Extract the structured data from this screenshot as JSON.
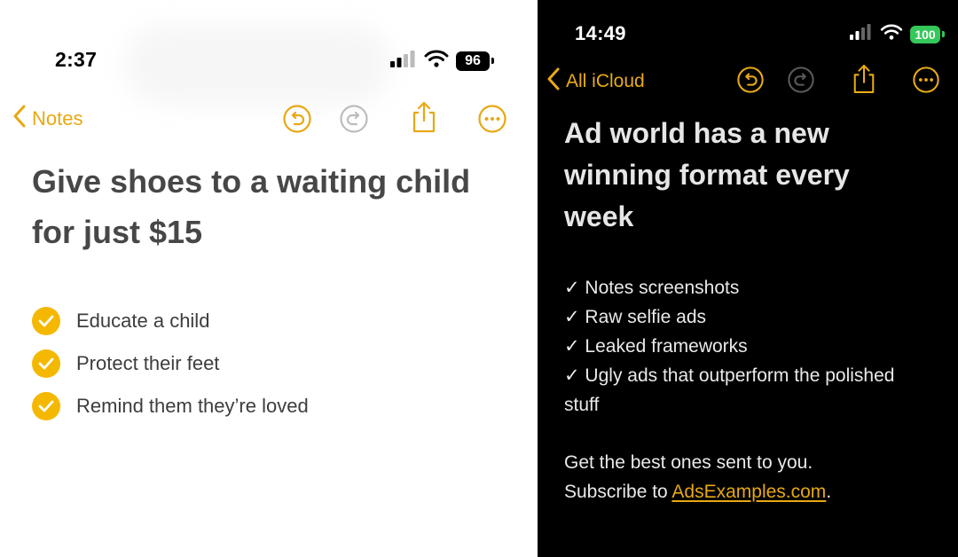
{
  "colors": {
    "accent": "#E7A812",
    "checkbox": "#F5B800",
    "battery_green": "#34C759"
  },
  "left": {
    "status": {
      "time": "2:37",
      "battery": "96",
      "icons": [
        "cellular-signal-icon",
        "wifi-icon",
        "battery-icon"
      ]
    },
    "nav": {
      "back_label": "Notes",
      "tools": [
        "undo-icon",
        "redo-icon",
        "share-icon",
        "more-icon"
      ]
    },
    "title_line1": "Give shoes to a waiting child",
    "title_line2": "for just $15",
    "checklist": [
      {
        "text": "Educate a child",
        "checked": true
      },
      {
        "text": "Protect their feet",
        "checked": true
      },
      {
        "text": "Remind them they’re loved",
        "checked": true
      }
    ]
  },
  "right": {
    "status": {
      "time": "14:49",
      "battery": "100",
      "icons": [
        "cellular-signal-icon",
        "wifi-icon",
        "battery-icon"
      ]
    },
    "nav": {
      "back_label": "All iCloud",
      "tools": [
        "undo-icon",
        "redo-icon",
        "share-icon",
        "more-icon"
      ]
    },
    "title_line1": "Ad world has a new",
    "title_line2": "winning format every",
    "title_line3": "week",
    "list": [
      "✓ Notes screenshots",
      "✓ Raw selfie ads",
      "✓ Leaked frameworks",
      "✓ Ugly ads that outperform the polished",
      "stuff"
    ],
    "footer_line1": "Get the best ones sent to you.",
    "footer_prefix": "Subscribe to ",
    "footer_link": "AdsExamples.com",
    "footer_suffix": "."
  }
}
